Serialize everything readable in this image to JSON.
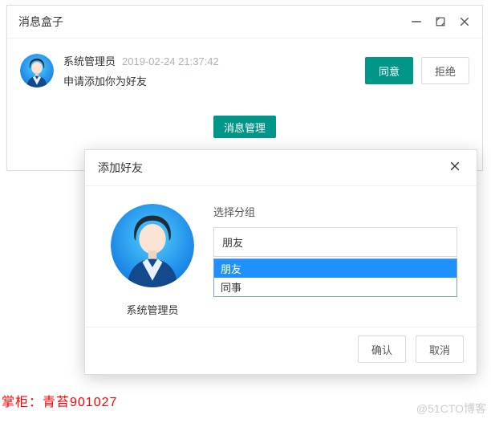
{
  "window": {
    "title": "消息盒子"
  },
  "message": {
    "sender": "系统管理员",
    "timestamp": "2019-02-24 21:37:42",
    "body": "申请添加你为好友",
    "accept_label": "同意",
    "decline_label": "拒绝"
  },
  "manage_button": "消息管理",
  "dialog": {
    "title": "添加好友",
    "user_name": "系统管理员",
    "group_label": "选择分组",
    "selected_group": "朋友",
    "options": {
      "opt0": "朋友",
      "opt1": "同事"
    },
    "confirm_label": "确认",
    "cancel_label": "取消"
  },
  "watermark": {
    "left": "掌柜：青苔901027",
    "right": "@51CTO博客"
  },
  "avatar_svg": "avatar"
}
